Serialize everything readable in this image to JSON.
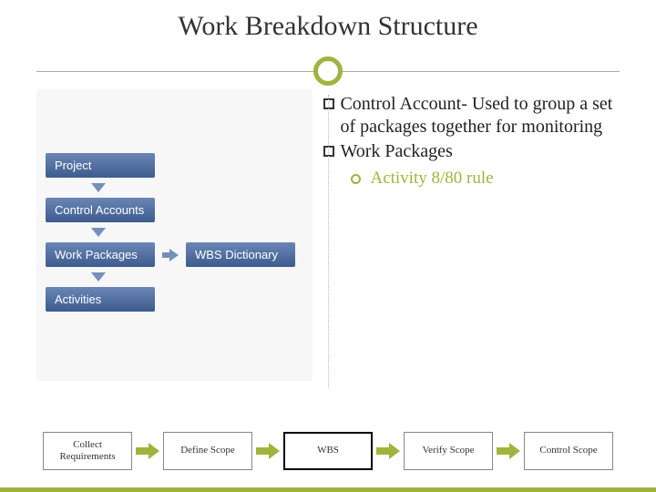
{
  "title": "Work Breakdown Structure",
  "diagram": {
    "box1": "Project",
    "box2": "Control Accounts",
    "box3": "Work Packages",
    "box3b": "WBS Dictionary",
    "box4": "Activities"
  },
  "bullets": {
    "b1_lead": "Control Account- ",
    "b1_rest": "Used to group a set of packages together for monitoring",
    "b2": "Work Packages",
    "sub1": "Activity 8/80 rule"
  },
  "flow": {
    "s1": "Collect Requirements",
    "s2": "Define Scope",
    "s3": "WBS",
    "s4": "Verify Scope",
    "s5": "Control Scope"
  }
}
